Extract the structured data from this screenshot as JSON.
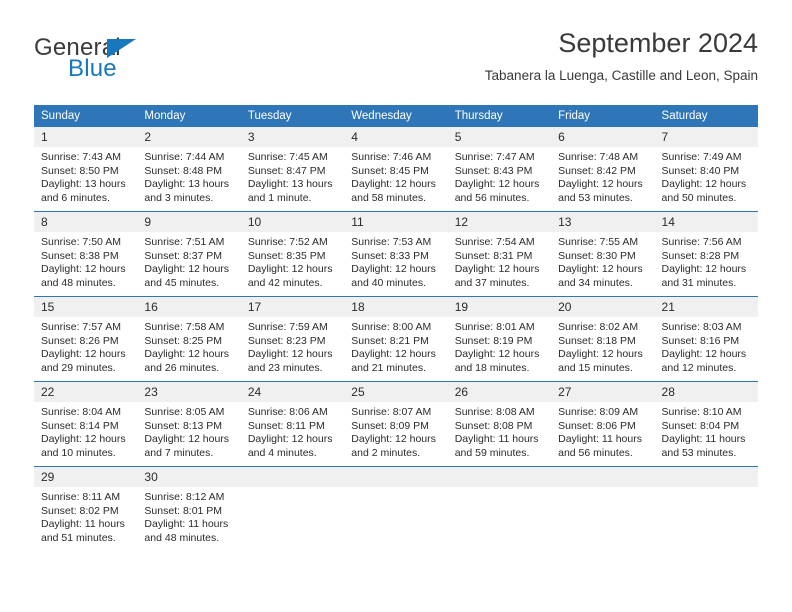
{
  "brand": {
    "name_top": "General",
    "name_bottom": "Blue",
    "triangle_color": "#1878be"
  },
  "header": {
    "title": "September 2024",
    "subtitle": "Tabanera la Luenga, Castille and Leon, Spain"
  },
  "theme": {
    "header_blue": "#2f76b8",
    "daynum_gray": "#f0f0f0",
    "text": "#2b2b2b"
  },
  "weekday_headers": [
    "Sunday",
    "Monday",
    "Tuesday",
    "Wednesday",
    "Thursday",
    "Friday",
    "Saturday"
  ],
  "weeks": [
    [
      {
        "day": "1",
        "sunrise": "Sunrise: 7:43 AM",
        "sunset": "Sunset: 8:50 PM",
        "daylight_1": "Daylight: 13 hours",
        "daylight_2": "and 6 minutes."
      },
      {
        "day": "2",
        "sunrise": "Sunrise: 7:44 AM",
        "sunset": "Sunset: 8:48 PM",
        "daylight_1": "Daylight: 13 hours",
        "daylight_2": "and 3 minutes."
      },
      {
        "day": "3",
        "sunrise": "Sunrise: 7:45 AM",
        "sunset": "Sunset: 8:47 PM",
        "daylight_1": "Daylight: 13 hours",
        "daylight_2": "and 1 minute."
      },
      {
        "day": "4",
        "sunrise": "Sunrise: 7:46 AM",
        "sunset": "Sunset: 8:45 PM",
        "daylight_1": "Daylight: 12 hours",
        "daylight_2": "and 58 minutes."
      },
      {
        "day": "5",
        "sunrise": "Sunrise: 7:47 AM",
        "sunset": "Sunset: 8:43 PM",
        "daylight_1": "Daylight: 12 hours",
        "daylight_2": "and 56 minutes."
      },
      {
        "day": "6",
        "sunrise": "Sunrise: 7:48 AM",
        "sunset": "Sunset: 8:42 PM",
        "daylight_1": "Daylight: 12 hours",
        "daylight_2": "and 53 minutes."
      },
      {
        "day": "7",
        "sunrise": "Sunrise: 7:49 AM",
        "sunset": "Sunset: 8:40 PM",
        "daylight_1": "Daylight: 12 hours",
        "daylight_2": "and 50 minutes."
      }
    ],
    [
      {
        "day": "8",
        "sunrise": "Sunrise: 7:50 AM",
        "sunset": "Sunset: 8:38 PM",
        "daylight_1": "Daylight: 12 hours",
        "daylight_2": "and 48 minutes."
      },
      {
        "day": "9",
        "sunrise": "Sunrise: 7:51 AM",
        "sunset": "Sunset: 8:37 PM",
        "daylight_1": "Daylight: 12 hours",
        "daylight_2": "and 45 minutes."
      },
      {
        "day": "10",
        "sunrise": "Sunrise: 7:52 AM",
        "sunset": "Sunset: 8:35 PM",
        "daylight_1": "Daylight: 12 hours",
        "daylight_2": "and 42 minutes."
      },
      {
        "day": "11",
        "sunrise": "Sunrise: 7:53 AM",
        "sunset": "Sunset: 8:33 PM",
        "daylight_1": "Daylight: 12 hours",
        "daylight_2": "and 40 minutes."
      },
      {
        "day": "12",
        "sunrise": "Sunrise: 7:54 AM",
        "sunset": "Sunset: 8:31 PM",
        "daylight_1": "Daylight: 12 hours",
        "daylight_2": "and 37 minutes."
      },
      {
        "day": "13",
        "sunrise": "Sunrise: 7:55 AM",
        "sunset": "Sunset: 8:30 PM",
        "daylight_1": "Daylight: 12 hours",
        "daylight_2": "and 34 minutes."
      },
      {
        "day": "14",
        "sunrise": "Sunrise: 7:56 AM",
        "sunset": "Sunset: 8:28 PM",
        "daylight_1": "Daylight: 12 hours",
        "daylight_2": "and 31 minutes."
      }
    ],
    [
      {
        "day": "15",
        "sunrise": "Sunrise: 7:57 AM",
        "sunset": "Sunset: 8:26 PM",
        "daylight_1": "Daylight: 12 hours",
        "daylight_2": "and 29 minutes."
      },
      {
        "day": "16",
        "sunrise": "Sunrise: 7:58 AM",
        "sunset": "Sunset: 8:25 PM",
        "daylight_1": "Daylight: 12 hours",
        "daylight_2": "and 26 minutes."
      },
      {
        "day": "17",
        "sunrise": "Sunrise: 7:59 AM",
        "sunset": "Sunset: 8:23 PM",
        "daylight_1": "Daylight: 12 hours",
        "daylight_2": "and 23 minutes."
      },
      {
        "day": "18",
        "sunrise": "Sunrise: 8:00 AM",
        "sunset": "Sunset: 8:21 PM",
        "daylight_1": "Daylight: 12 hours",
        "daylight_2": "and 21 minutes."
      },
      {
        "day": "19",
        "sunrise": "Sunrise: 8:01 AM",
        "sunset": "Sunset: 8:19 PM",
        "daylight_1": "Daylight: 12 hours",
        "daylight_2": "and 18 minutes."
      },
      {
        "day": "20",
        "sunrise": "Sunrise: 8:02 AM",
        "sunset": "Sunset: 8:18 PM",
        "daylight_1": "Daylight: 12 hours",
        "daylight_2": "and 15 minutes."
      },
      {
        "day": "21",
        "sunrise": "Sunrise: 8:03 AM",
        "sunset": "Sunset: 8:16 PM",
        "daylight_1": "Daylight: 12 hours",
        "daylight_2": "and 12 minutes."
      }
    ],
    [
      {
        "day": "22",
        "sunrise": "Sunrise: 8:04 AM",
        "sunset": "Sunset: 8:14 PM",
        "daylight_1": "Daylight: 12 hours",
        "daylight_2": "and 10 minutes."
      },
      {
        "day": "23",
        "sunrise": "Sunrise: 8:05 AM",
        "sunset": "Sunset: 8:13 PM",
        "daylight_1": "Daylight: 12 hours",
        "daylight_2": "and 7 minutes."
      },
      {
        "day": "24",
        "sunrise": "Sunrise: 8:06 AM",
        "sunset": "Sunset: 8:11 PM",
        "daylight_1": "Daylight: 12 hours",
        "daylight_2": "and 4 minutes."
      },
      {
        "day": "25",
        "sunrise": "Sunrise: 8:07 AM",
        "sunset": "Sunset: 8:09 PM",
        "daylight_1": "Daylight: 12 hours",
        "daylight_2": "and 2 minutes."
      },
      {
        "day": "26",
        "sunrise": "Sunrise: 8:08 AM",
        "sunset": "Sunset: 8:08 PM",
        "daylight_1": "Daylight: 11 hours",
        "daylight_2": "and 59 minutes."
      },
      {
        "day": "27",
        "sunrise": "Sunrise: 8:09 AM",
        "sunset": "Sunset: 8:06 PM",
        "daylight_1": "Daylight: 11 hours",
        "daylight_2": "and 56 minutes."
      },
      {
        "day": "28",
        "sunrise": "Sunrise: 8:10 AM",
        "sunset": "Sunset: 8:04 PM",
        "daylight_1": "Daylight: 11 hours",
        "daylight_2": "and 53 minutes."
      }
    ],
    [
      {
        "day": "29",
        "sunrise": "Sunrise: 8:11 AM",
        "sunset": "Sunset: 8:02 PM",
        "daylight_1": "Daylight: 11 hours",
        "daylight_2": "and 51 minutes."
      },
      {
        "day": "30",
        "sunrise": "Sunrise: 8:12 AM",
        "sunset": "Sunset: 8:01 PM",
        "daylight_1": "Daylight: 11 hours",
        "daylight_2": "and 48 minutes."
      },
      {
        "day": "",
        "sunrise": "",
        "sunset": "",
        "daylight_1": "",
        "daylight_2": ""
      },
      {
        "day": "",
        "sunrise": "",
        "sunset": "",
        "daylight_1": "",
        "daylight_2": ""
      },
      {
        "day": "",
        "sunrise": "",
        "sunset": "",
        "daylight_1": "",
        "daylight_2": ""
      },
      {
        "day": "",
        "sunrise": "",
        "sunset": "",
        "daylight_1": "",
        "daylight_2": ""
      },
      {
        "day": "",
        "sunrise": "",
        "sunset": "",
        "daylight_1": "",
        "daylight_2": ""
      }
    ]
  ]
}
